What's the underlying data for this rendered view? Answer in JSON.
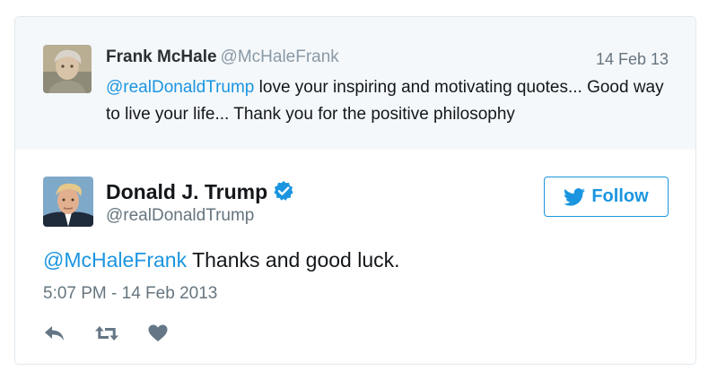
{
  "quoted_tweet": {
    "author_name": "Frank McHale",
    "author_handle": "@McHaleFrank",
    "date": "14 Feb 13",
    "mention": "@realDonaldTrump",
    "text": " love your inspiring and motivating quotes... Good way to live your life... Thank you for the positive philosophy",
    "avatar_icon": "user-avatar-photo"
  },
  "main_tweet": {
    "author_name": "Donald J. Trump",
    "author_handle": "@realDonaldTrump",
    "verified_icon": "verified-badge-icon",
    "follow_label": "Follow",
    "mention": "@McHaleFrank",
    "text": " Thanks and good luck.",
    "timestamp": "5:07 PM - 14 Feb 2013",
    "avatar_icon": "user-avatar-photo"
  },
  "actions": {
    "reply_icon": "reply-icon",
    "retweet_icon": "retweet-icon",
    "like_icon": "heart-icon"
  },
  "colors": {
    "link": "#1b95e0",
    "quoted_background": "#f5f8fa",
    "secondary_text": "#66757f",
    "action_icon": "#657786"
  }
}
